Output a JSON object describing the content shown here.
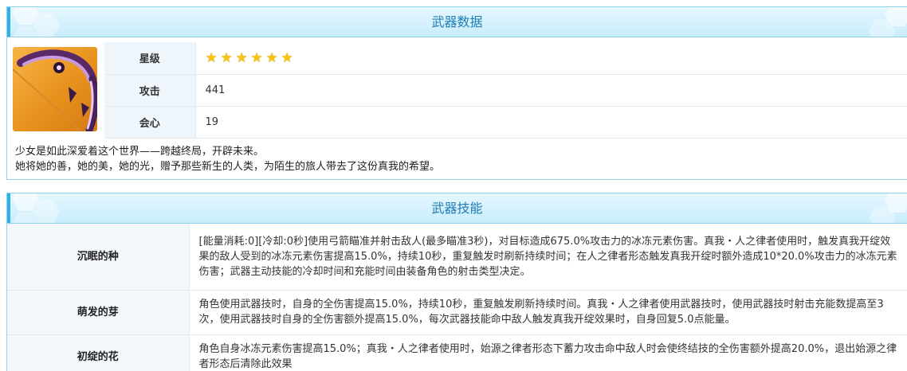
{
  "weapon": {
    "header_title": "武器数据",
    "stats": [
      {
        "label": "星级",
        "value": "",
        "stars": 6
      },
      {
        "label": "攻击",
        "value": "441"
      },
      {
        "label": "会心",
        "value": "19"
      }
    ],
    "description": [
      "少女是如此深爱着这个世界——跨越终局，开辟未来。",
      "她将她的善，她的美，她的光，赠予那些新生的人类，为陌生的旅人带去了这份真我的希望。"
    ]
  },
  "skills": {
    "header_title": "武器技能",
    "items": [
      {
        "name": "沉眠的种",
        "text": "[能量消耗:0][冷却:0秒]使用弓箭瞄准并射击敌人(最多瞄准3秒)，对目标造成675.0%攻击力的冰冻元素伤害。真我・人之律者使用时，触发真我开绽效果的敌人受到的冰冻元素伤害提高15.0%，持续10秒，重复触发时刷新持续时间；在人之律者形态触发真我开绽时额外造成10*20.0%攻击力的冰冻元素伤害；武器主动技能的冷却时间和充能时间由装备角色的射击类型决定。"
      },
      {
        "name": "萌发的芽",
        "text": "角色使用武器技时，自身的全伤害提高15.0%，持续10秒，重复触发刷新持续时间。真我・人之律者使用武器技时，使用武器技时射击充能数提高至3次，使用武器技时自身的全伤害额外提高15.0%，每次武器技能命中敌人触发真我开绽效果时，自身回复5.0点能量。"
      },
      {
        "name": "初绽的花",
        "text": "角色自身冰冻元素伤害提高15.0%；真我・人之律者使用时，始源之律者形态下蓄力攻击命中敌人时会使终结技的全伤害额外提高20.0%，退出始源之律者形态后清除此效果"
      }
    ]
  },
  "colors": {
    "accent": "#2fb1e6",
    "header_bg": "#c9ecfb",
    "title_text": "#1d7eb3",
    "star": "#f6c411",
    "image_bg": "#e8921e"
  },
  "icons": {
    "star": "star-icon",
    "weapon": "bow-weapon-icon"
  }
}
